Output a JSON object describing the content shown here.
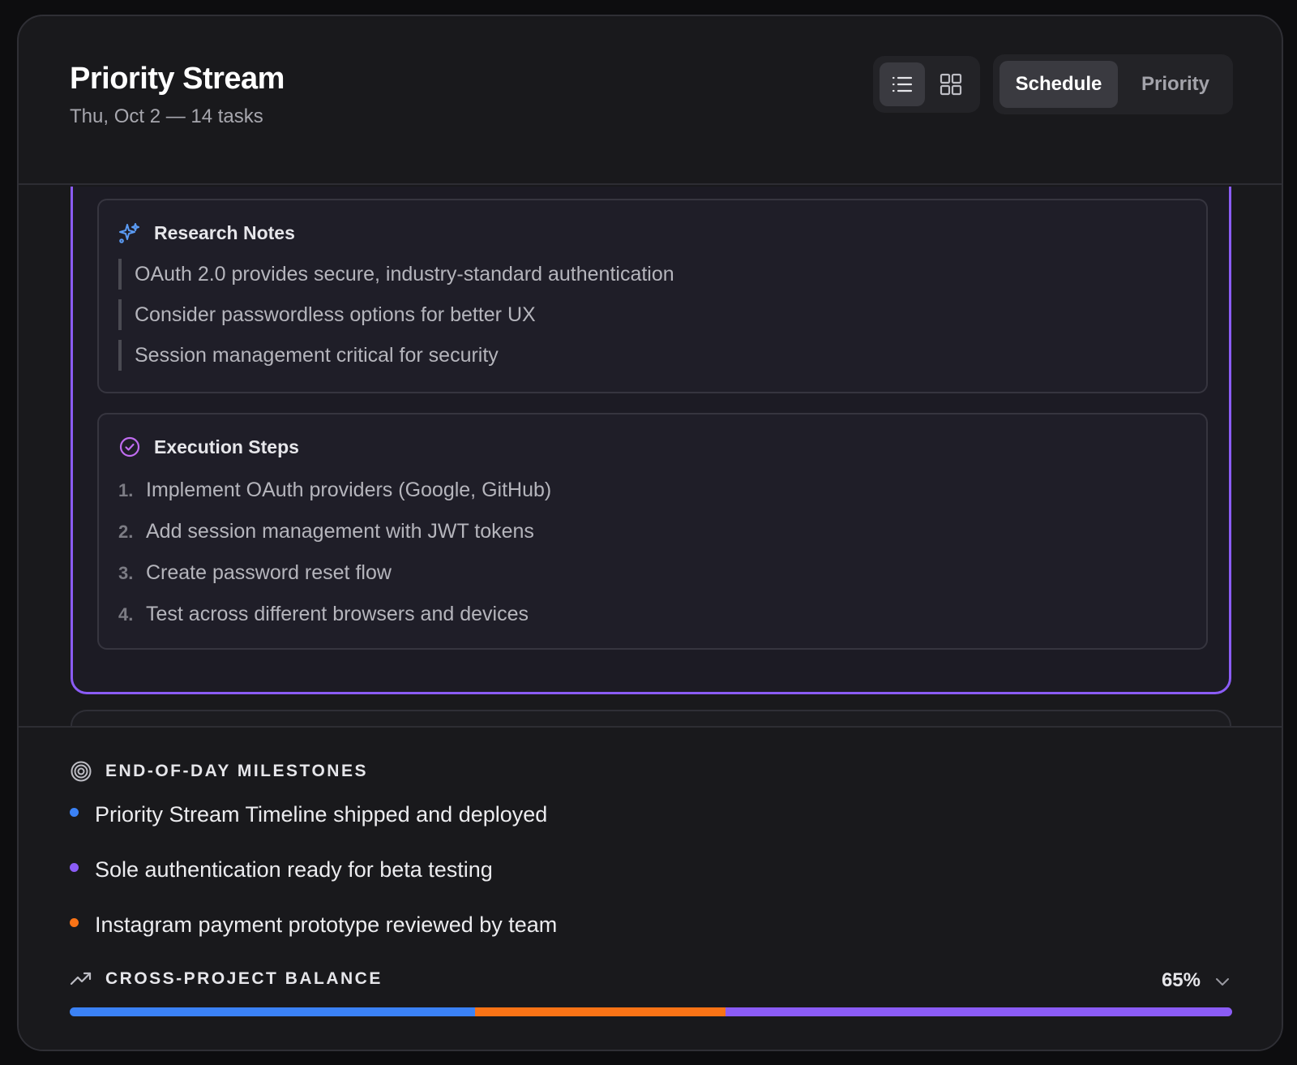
{
  "header": {
    "title": "Priority Stream",
    "subtitle": "Thu, Oct 2 — 14 tasks",
    "view_toggle": [
      {
        "icon": "list-icon",
        "active": true
      },
      {
        "icon": "grid-icon",
        "active": false
      }
    ],
    "mode_toggle": {
      "schedule_label": "Schedule",
      "priority_label": "Priority",
      "active": "Schedule"
    }
  },
  "task": {
    "accent_color": "#8b5cf6",
    "research": {
      "title": "Research Notes",
      "icon": "sparkles-icon",
      "notes": [
        "OAuth 2.0 provides secure, industry-standard authentication",
        "Consider passwordless options for better UX",
        "Session management critical for security"
      ]
    },
    "steps": {
      "title": "Execution Steps",
      "icon": "check-circle-icon",
      "items": [
        {
          "num": "1.",
          "text": "Implement OAuth providers (Google, GitHub)"
        },
        {
          "num": "2.",
          "text": "Add session management with JWT tokens"
        },
        {
          "num": "3.",
          "text": "Create password reset flow"
        },
        {
          "num": "4.",
          "text": "Test across different browsers and devices"
        }
      ]
    }
  },
  "milestones": {
    "title": "END-OF-DAY MILESTONES",
    "icon": "target-icon",
    "items": [
      {
        "text": "Priority Stream Timeline shipped and deployed",
        "color": "#3b82f6"
      },
      {
        "text": "Sole authentication ready for beta testing",
        "color": "#8b5cf6"
      },
      {
        "text": "Instagram payment prototype reviewed by team",
        "color": "#f97316"
      }
    ]
  },
  "balance": {
    "title": "CROSS-PROJECT BALANCE",
    "icon": "trending-up-icon",
    "percent": "65%",
    "segments": [
      {
        "color": "#3b82f6",
        "fraction": 0.349
      },
      {
        "color": "#f97316",
        "fraction": 0.215
      },
      {
        "color": "#8b5cf6",
        "fraction": 0.436
      }
    ]
  }
}
